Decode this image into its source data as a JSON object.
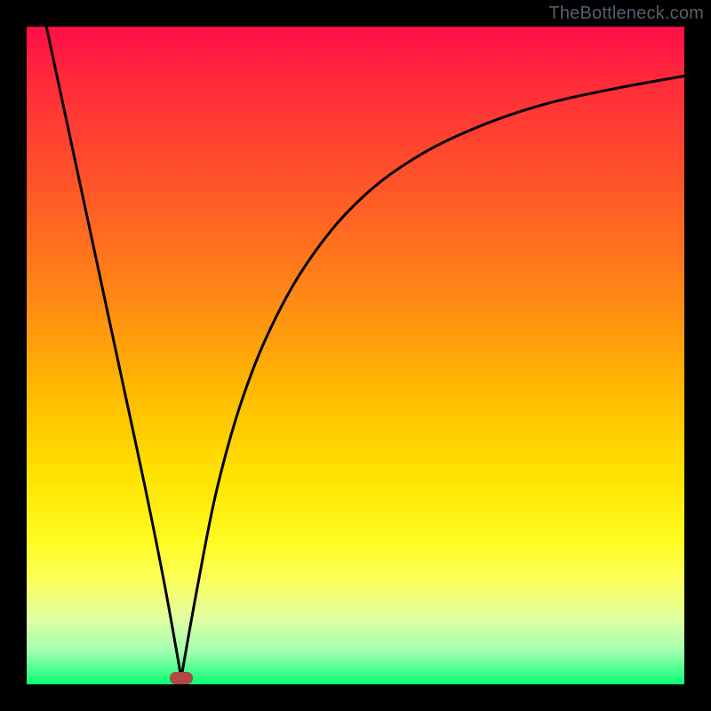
{
  "watermark": {
    "text": "TheBottleneck.com"
  },
  "chart_data": {
    "type": "line",
    "title": "",
    "xlabel": "",
    "ylabel": "",
    "xlim": [
      0,
      100
    ],
    "ylim": [
      0,
      100
    ],
    "grid": false,
    "legend": false,
    "series": [
      {
        "name": "left-branch",
        "x": [
          3,
          6,
          9,
          12,
          15,
          18,
          21,
          23.5
        ],
        "values": [
          100,
          86,
          72,
          58,
          44,
          30,
          15,
          1
        ]
      },
      {
        "name": "right-branch",
        "x": [
          23.5,
          26,
          29,
          33,
          38,
          44,
          51,
          59,
          68,
          78,
          89,
          100
        ],
        "values": [
          1,
          15,
          30,
          44,
          56,
          66,
          74,
          80,
          84.5,
          88,
          90.5,
          92.5
        ]
      }
    ],
    "marker": {
      "x": 23.5,
      "y": 1,
      "color": "#b24848",
      "shape": "pill"
    },
    "background_gradient": {
      "type": "vertical",
      "stops": [
        {
          "pos": 0,
          "color": "#ff0e48"
        },
        {
          "pos": 24,
          "color": "#ff5529"
        },
        {
          "pos": 55,
          "color": "#ffb800"
        },
        {
          "pos": 78,
          "color": "#fffb20"
        },
        {
          "pos": 95,
          "color": "#a0ffb0"
        },
        {
          "pos": 100,
          "color": "#0aff72"
        }
      ]
    }
  }
}
